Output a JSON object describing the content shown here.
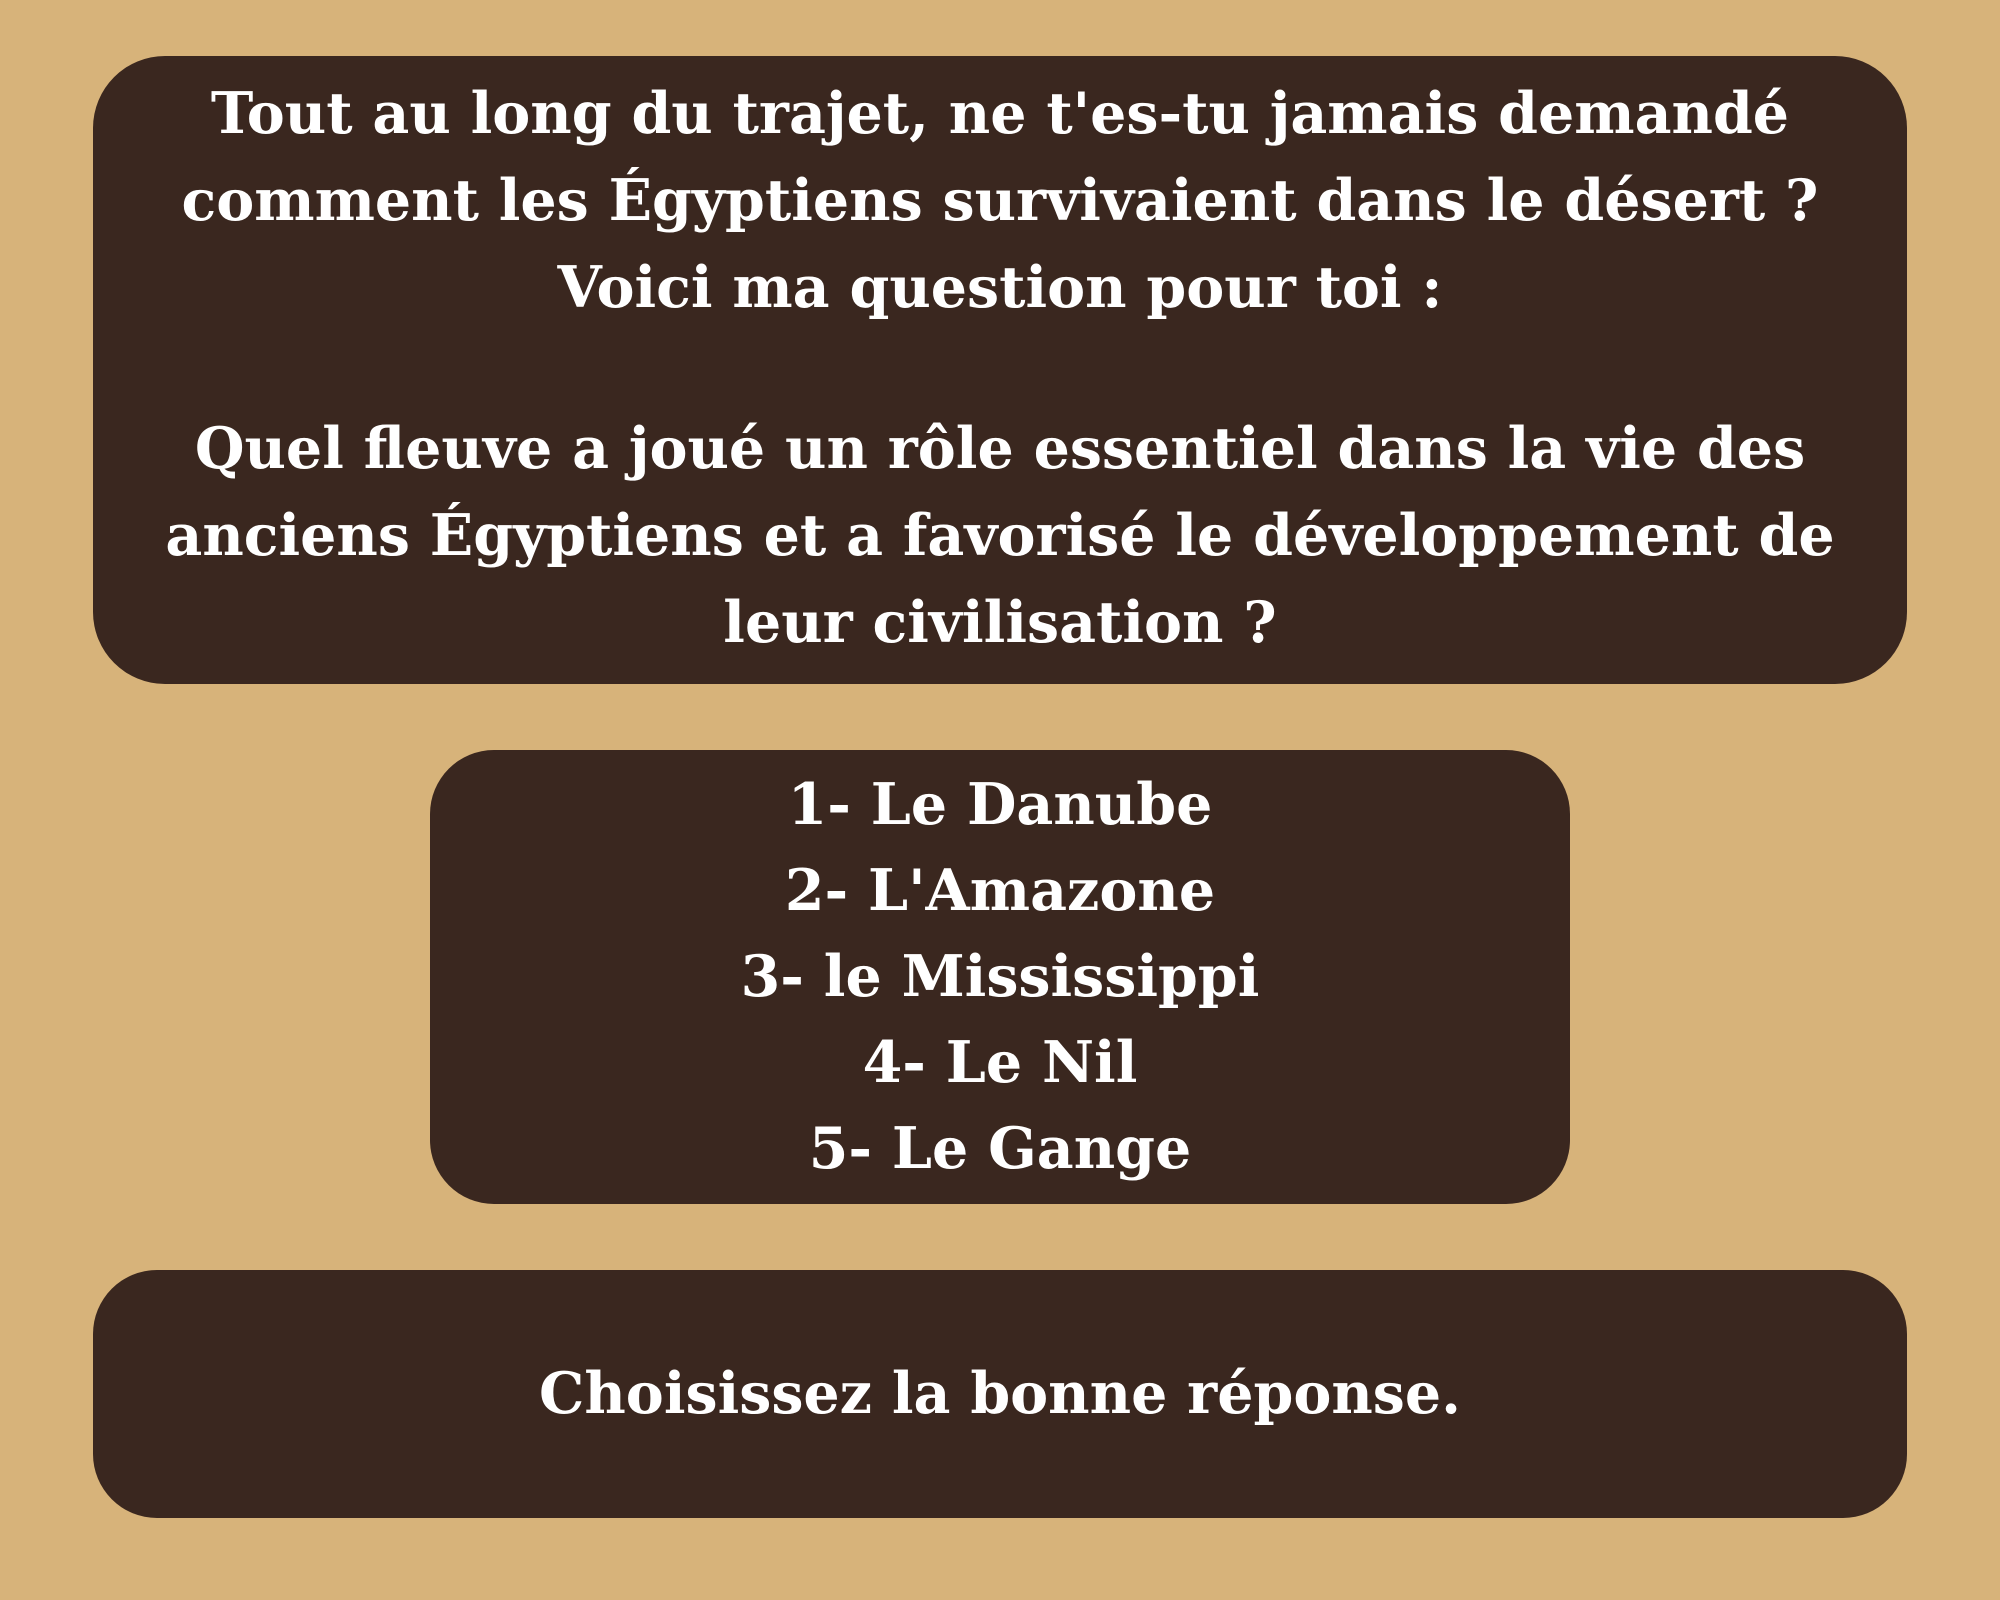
{
  "question_panel": {
    "intro": "Tout au long du trajet, ne t'es-tu jamais demandé comment les Égyptiens survivaient dans le désert ? Voici ma question pour toi :",
    "question": "Quel fleuve a joué un rôle essentiel dans la vie des anciens Égyptiens et a favorisé le développement de leur civilisation ?"
  },
  "answers": [
    "1- Le Danube",
    "2- L'Amazone",
    "3- le Mississippi",
    "4- Le Nil",
    "5- Le Gange"
  ],
  "instruction": "Choisissez la bonne réponse.",
  "colors": {
    "background": "#d7b37a",
    "panel": "#3a271f",
    "text": "#ffffff"
  }
}
